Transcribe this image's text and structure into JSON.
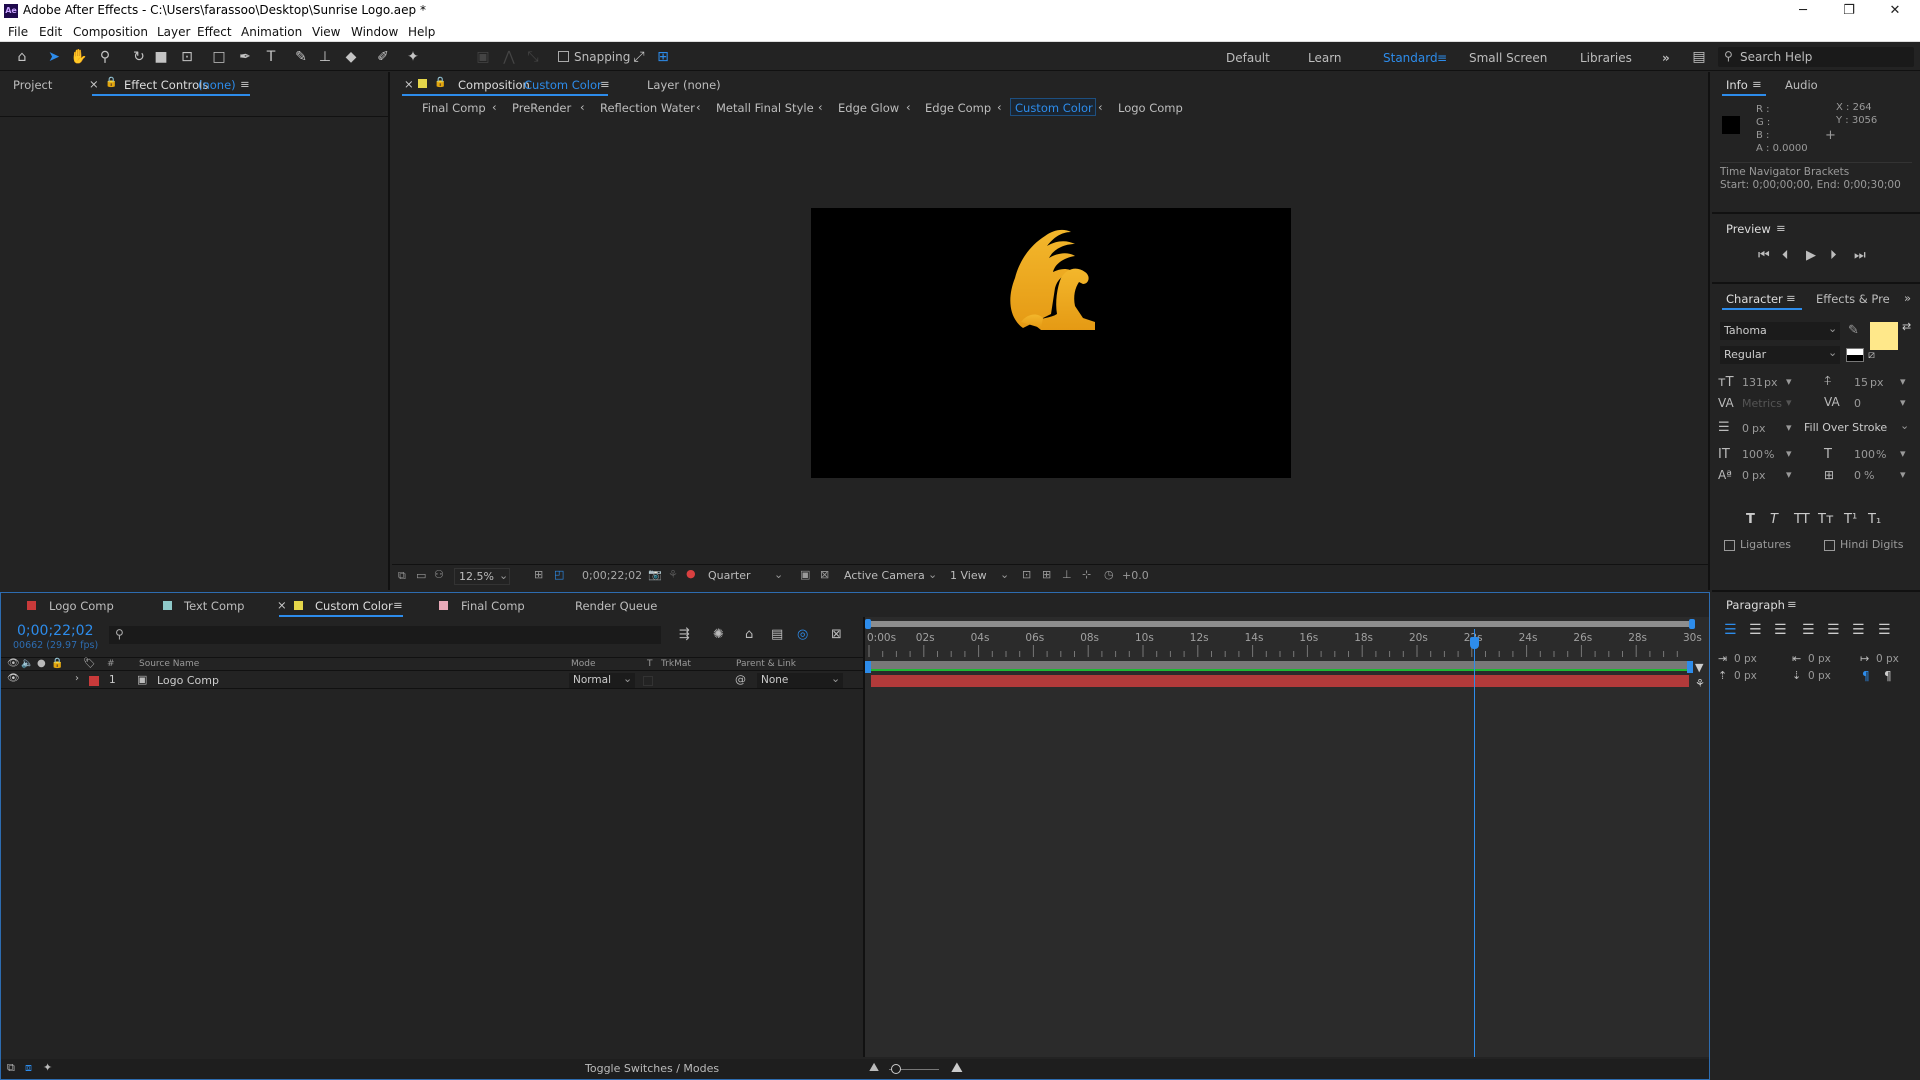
{
  "window": {
    "title": "Adobe After Effects - C:\\Users\\farassoo\\Desktop\\Sunrise Logo.aep *",
    "app_icon": "Ae",
    "min_symbol": "─",
    "restore_symbol": "❐",
    "close_symbol": "✕"
  },
  "menu": [
    "File",
    "Edit",
    "Composition",
    "Layer",
    "Effect",
    "Animation",
    "View",
    "Window",
    "Help"
  ],
  "toolbar": {
    "snapping_label": "Snapping",
    "workspaces": [
      "Default",
      "Learn",
      "Standard",
      "Small Screen",
      "Libraries"
    ],
    "active_workspace": "Standard",
    "search_placeholder": "Search Help",
    "more": "»"
  },
  "project_panel": {
    "tab_project": "Project",
    "tab_effect_controls": "Effect Controls",
    "effect_controls_target": "(none)"
  },
  "composition_panel": {
    "tab_label": "Composition",
    "comp_name": "Custom Color",
    "layer_tab": "Layer",
    "layer_value": "(none)",
    "flowchart": [
      "Final Comp",
      "PreRender",
      "Reflection Water",
      "Metall Final Style",
      "Edge Glow",
      "Edge Comp",
      "Custom Color",
      "Logo Comp"
    ],
    "active_flow": "Custom Color",
    "zoom": "12.5%",
    "timecode": "0;00;22;02",
    "resolution": "Quarter",
    "camera": "Active Camera",
    "views": "1 View",
    "exposure": "+0.0"
  },
  "timeline": {
    "tabs": [
      {
        "label": "Logo Comp",
        "color": "#c83a3a"
      },
      {
        "label": "Text Comp",
        "color": "#8fc9c9"
      },
      {
        "label": "Custom Color",
        "color": "#e5d64a"
      },
      {
        "label": "Final Comp",
        "color": "#e8a9b8"
      },
      {
        "label": "Render Queue",
        "color": ""
      }
    ],
    "active_tab": "Custom Color",
    "current_time": "0;00;22;02",
    "frame_info": "00662 (29.97 fps)",
    "search_icon": "search-icon",
    "columns": {
      "num": "#",
      "source": "Source Name",
      "mode": "Mode",
      "t": "T",
      "trkmat": "TrkMat",
      "parent": "Parent & Link"
    },
    "layers": [
      {
        "num": "1",
        "name": "Logo Comp",
        "mode": "Normal",
        "parent": "None",
        "color": "#c83a3a"
      }
    ],
    "ruler": [
      "0:00s",
      "02s",
      "04s",
      "06s",
      "08s",
      "10s",
      "12s",
      "14s",
      "16s",
      "18s",
      "20s",
      "22s",
      "24s",
      "26s",
      "28s",
      "30s"
    ],
    "playhead_fraction": 0.7356,
    "toggle_label": "Toggle Switches / Modes"
  },
  "info_panel": {
    "tab_info": "Info",
    "tab_audio": "Audio",
    "r": "R :",
    "g": "G :",
    "b": "B :",
    "a": "A :  0.0000",
    "x": "X : 264",
    "y": "Y : 3056",
    "nav_title": "Time Navigator Brackets",
    "nav_range": "Start: 0;00;00;00, End: 0;00;30;00"
  },
  "preview_panel": {
    "title": "Preview"
  },
  "character_panel": {
    "tab_character": "Character",
    "tab_effects": "Effects & Pre",
    "font": "Tahoma",
    "style": "Regular",
    "size": "131",
    "size_unit": "px",
    "leading": "15",
    "leading_unit": "px",
    "kerning": "Metrics",
    "tracking": "0",
    "stroke_width": "0",
    "stroke_unit": "px",
    "stroke_mode": "Fill Over Stroke",
    "vscale": "100",
    "hscale": "100",
    "pct": "%",
    "baseline": "0",
    "baseline_unit": "px",
    "tsume": "0",
    "tsume_unit": "%",
    "fill_color": "#ffe88a",
    "styles": [
      "T",
      "T",
      "TT",
      "Tт",
      "T¹",
      "T₁"
    ],
    "ligatures": "Ligatures",
    "hindi_digits": "Hindi Digits"
  },
  "paragraph_panel": {
    "title": "Paragraph",
    "indent_left": "0",
    "indent_first": "0",
    "indent_right": "0",
    "space_before": "0",
    "space_after": "0",
    "unit": "px"
  },
  "colors": {
    "accent": "#2d8ceb",
    "bg": "#232323",
    "layer_bar": "#b23a3a",
    "work_area": "#1fb833"
  }
}
